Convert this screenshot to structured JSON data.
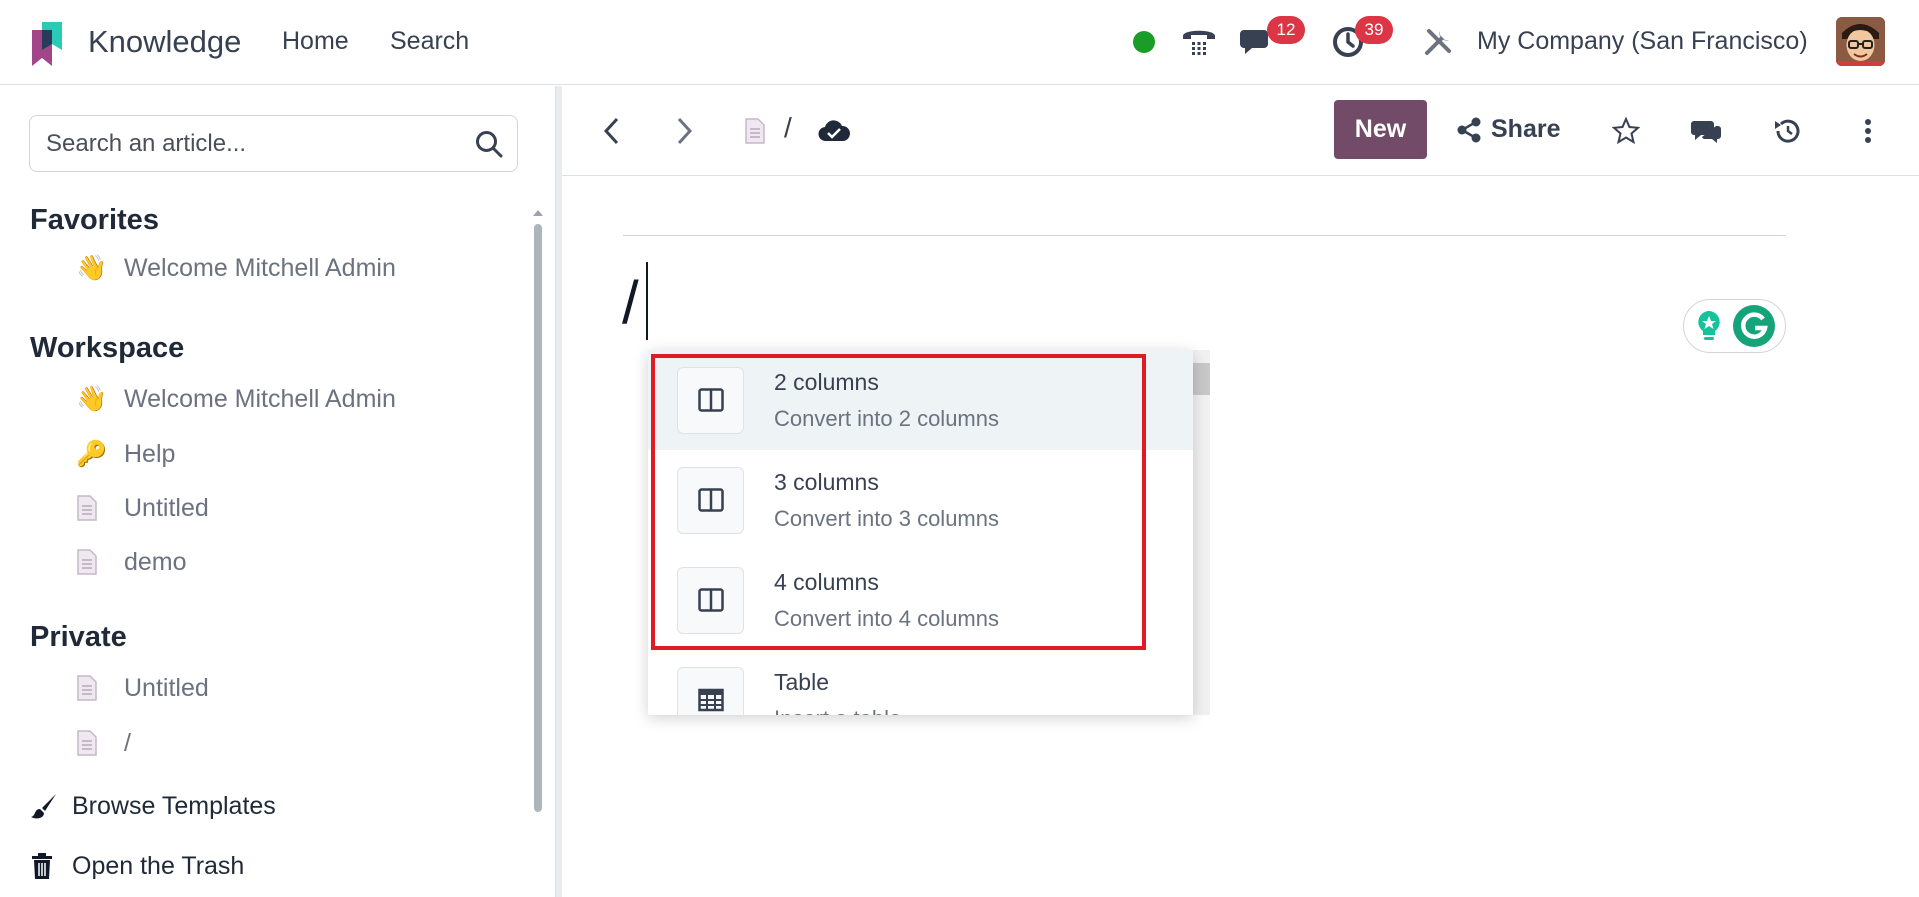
{
  "app": {
    "name": "Knowledge"
  },
  "nav": {
    "links": [
      "Home",
      "Search"
    ]
  },
  "systray": {
    "messages_badge": "12",
    "activities_badge": "39",
    "company": "My Company (San Francisco)"
  },
  "sidebar": {
    "search_placeholder": "Search an article...",
    "favorites": {
      "title": "Favorites",
      "items": [
        {
          "emoji": "👋",
          "label": "Welcome Mitchell Admin"
        }
      ]
    },
    "workspace": {
      "title": "Workspace",
      "items": [
        {
          "emoji": "👋",
          "label": "Welcome Mitchell Admin"
        },
        {
          "emoji": "🔑",
          "label": "Help"
        },
        {
          "icon": "document-icon",
          "label": "Untitled"
        },
        {
          "icon": "document-icon",
          "label": "demo"
        }
      ]
    },
    "private": {
      "title": "Private",
      "items": [
        {
          "icon": "document-icon",
          "label": "Untitled"
        },
        {
          "icon": "document-icon",
          "label": "/"
        }
      ]
    },
    "browse_templates": "Browse Templates",
    "open_trash": "Open the Trash"
  },
  "toolbar": {
    "breadcrumb": "/",
    "new_label": "New",
    "share_label": "Share"
  },
  "editor": {
    "content": "/"
  },
  "powerbox": {
    "items": [
      {
        "title": "2 columns",
        "description": "Convert into 2 columns",
        "icon": "columns-icon"
      },
      {
        "title": "3 columns",
        "description": "Convert into 3 columns",
        "icon": "columns-icon"
      },
      {
        "title": "4 columns",
        "description": "Convert into 4 columns",
        "icon": "columns-icon"
      },
      {
        "title": "Table",
        "description": "Insert a table",
        "icon": "table-icon"
      }
    ]
  },
  "colors": {
    "brand": "#714b67",
    "badge": "#dc3545",
    "online": "#1a9c29",
    "highlight": "#e01b24",
    "logo_teal": "#1fc8b0",
    "logo_pink": "#a24689"
  }
}
